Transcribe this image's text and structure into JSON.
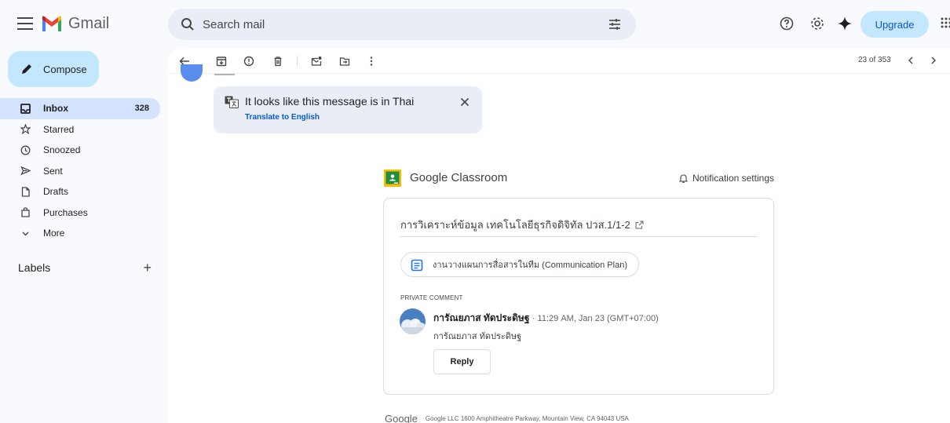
{
  "app": {
    "name": "Gmail",
    "search_placeholder": "Search mail",
    "upgrade_label": "Upgrade",
    "brand_colors": {
      "red": "#ea4335",
      "blue": "#4285f4",
      "green": "#34a853",
      "yellow": "#fbbc04"
    }
  },
  "sidebar": {
    "compose_label": "Compose",
    "items": [
      {
        "label": "Inbox",
        "icon": "inbox-icon",
        "count": "328",
        "active": true
      },
      {
        "label": "Starred",
        "icon": "star-icon"
      },
      {
        "label": "Snoozed",
        "icon": "clock-icon"
      },
      {
        "label": "Sent",
        "icon": "send-icon"
      },
      {
        "label": "Drafts",
        "icon": "draft-icon"
      },
      {
        "label": "Purchases",
        "icon": "shopping-bag-icon"
      },
      {
        "label": "More",
        "icon": "chevron-down-icon"
      }
    ],
    "labels_title": "Labels",
    "labels_add": "+"
  },
  "toolbar": {
    "pager": "23 of 353"
  },
  "translate_banner": {
    "message": "It looks like this message is in Thai",
    "link": "Translate to English"
  },
  "email": {
    "brand_google": "Google",
    "brand_product": " Classroom",
    "notification_settings": "Notification settings",
    "course_title": "การวิเคราะห์ข้อมูล เทคโนโลยีธุรกิจดิจิทัล ปวส.1/1-2",
    "assignment_title": "งานวางแผนการสื่อสารในทีม (Communication Plan)",
    "private_comment_label": "PRIVATE COMMENT",
    "commenter_name": "การัณยภาส ทัดประดิษฐ",
    "comment_time": "11:29 AM, Jan 23 (GMT+07:00)",
    "comment_text": "การัณยภาส ทัดประดิษฐ",
    "reply_label": "Reply",
    "footer_logo": "Google",
    "footer_address": "Google LLC 1600 Amphitheatre Parkway, Mountain View, CA 94043 USA"
  }
}
